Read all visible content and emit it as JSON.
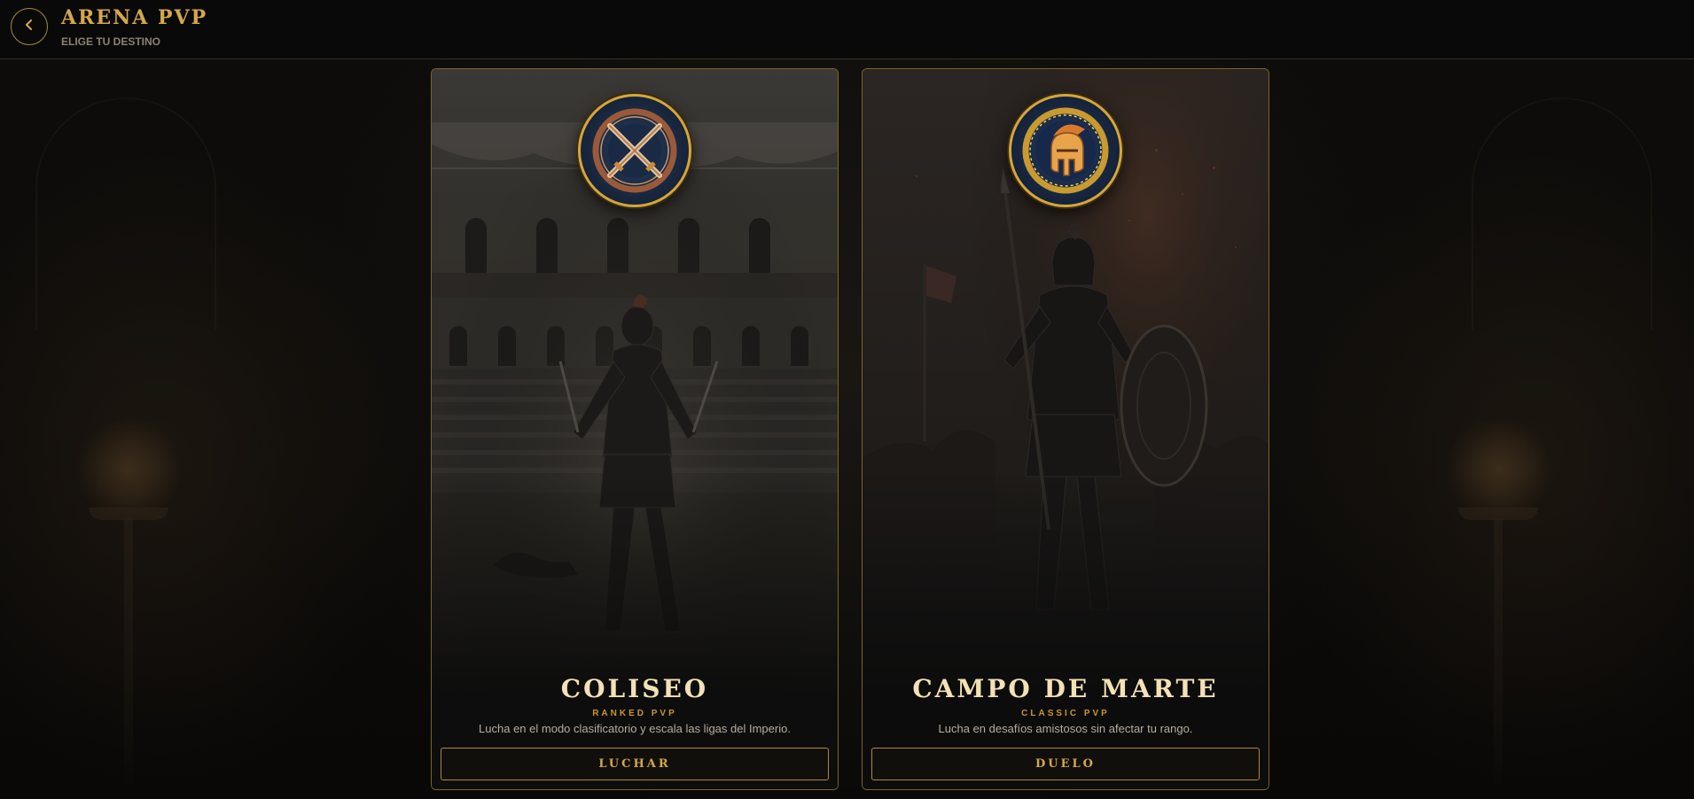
{
  "header": {
    "title": "ARENA PVP",
    "subtitle": "ELIGE TU DESTINO",
    "back_icon": "chevron-left-icon"
  },
  "colors": {
    "accent_gold": "#d4a84b",
    "title_cream": "#f3e2b6",
    "border_gold": "#7a6428",
    "background": "#0b0a09"
  },
  "modes": [
    {
      "title": "COLISEO",
      "mode": "RANKED PVP",
      "description": "Lucha en el modo clasificatorio y escala las ligas del Imperio.",
      "button": "LUCHAR",
      "emblem_icon": "crossed-swords-icon",
      "art": "gladiator-in-colosseum"
    },
    {
      "title": "CAMPO DE MARTE",
      "mode": "CLASSIC PVP",
      "description": "Lucha en desafíos amistosos sin afectar tu rango.",
      "button": "DUELO",
      "emblem_icon": "spartan-helmet-icon",
      "art": "armored-warrior-battlefield"
    }
  ]
}
